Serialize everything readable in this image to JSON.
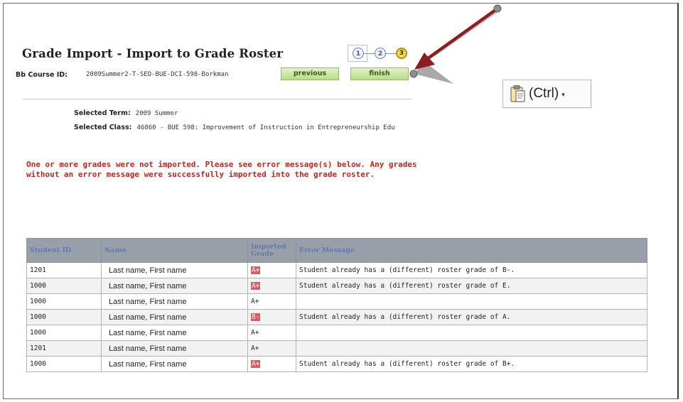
{
  "header": {
    "title": "Grade Import - Import to Grade Roster",
    "course_label": "Bb Course ID:",
    "course_value": "2009Summer2-T-SED-BUE-DCI-598-Borkman"
  },
  "wizard": {
    "steps": [
      "1",
      "2",
      "3"
    ],
    "current_step": "3",
    "previous_label": "previous",
    "finish_label": "finish"
  },
  "selection": {
    "term_label": "Selected Term:",
    "term_value": "2009 Summer",
    "class_label": "Selected Class:",
    "class_value": "46860 - BUE 598: Improvement of Instruction in Entrepreneurship Edu"
  },
  "message": {
    "error_text": "One or more grades were not imported. Please see error message(s) below. Any grades without an error message were successfully imported into the grade roster."
  },
  "paste_options": {
    "label": "(Ctrl)",
    "icon": "clipboard-icon",
    "caret": "▾"
  },
  "annotation": {
    "arrow_color": "#8b1e1e",
    "arrow_icon": "arrow-pointer-icon"
  },
  "table": {
    "columns": [
      "Student ID",
      "Name",
      "Imported Grade",
      "Error Message"
    ],
    "rows": [
      {
        "id": "1201",
        "name": "Last name, First name",
        "grade": "A+",
        "grade_flagged": true,
        "error": "Student already has a (different) roster grade of B-."
      },
      {
        "id": "1000",
        "name": "Last name, First name",
        "grade": "A+",
        "grade_flagged": true,
        "error": "Student already has a (different) roster grade of E."
      },
      {
        "id": "1000",
        "name": "Last name, First name",
        "grade": "A+",
        "grade_flagged": false,
        "error": ""
      },
      {
        "id": "1000",
        "name": "Last name, First name",
        "grade": "B-",
        "grade_flagged": true,
        "error": "Student already has a (different) roster grade of A."
      },
      {
        "id": "1000",
        "name": "Last name, First name",
        "grade": "A+",
        "grade_flagged": false,
        "error": ""
      },
      {
        "id": "1201",
        "name": "Last name, First name",
        "grade": "A+",
        "grade_flagged": false,
        "error": ""
      },
      {
        "id": "1000",
        "name": "Last name, First name",
        "grade": "A+",
        "grade_flagged": true,
        "error": "Student already has a (different) roster grade of B+."
      }
    ]
  },
  "colors": {
    "error_red": "#c8221d",
    "button_green": "#b9dc8a",
    "header_gray": "#999fa8",
    "grade_highlight": "#e7545a"
  }
}
